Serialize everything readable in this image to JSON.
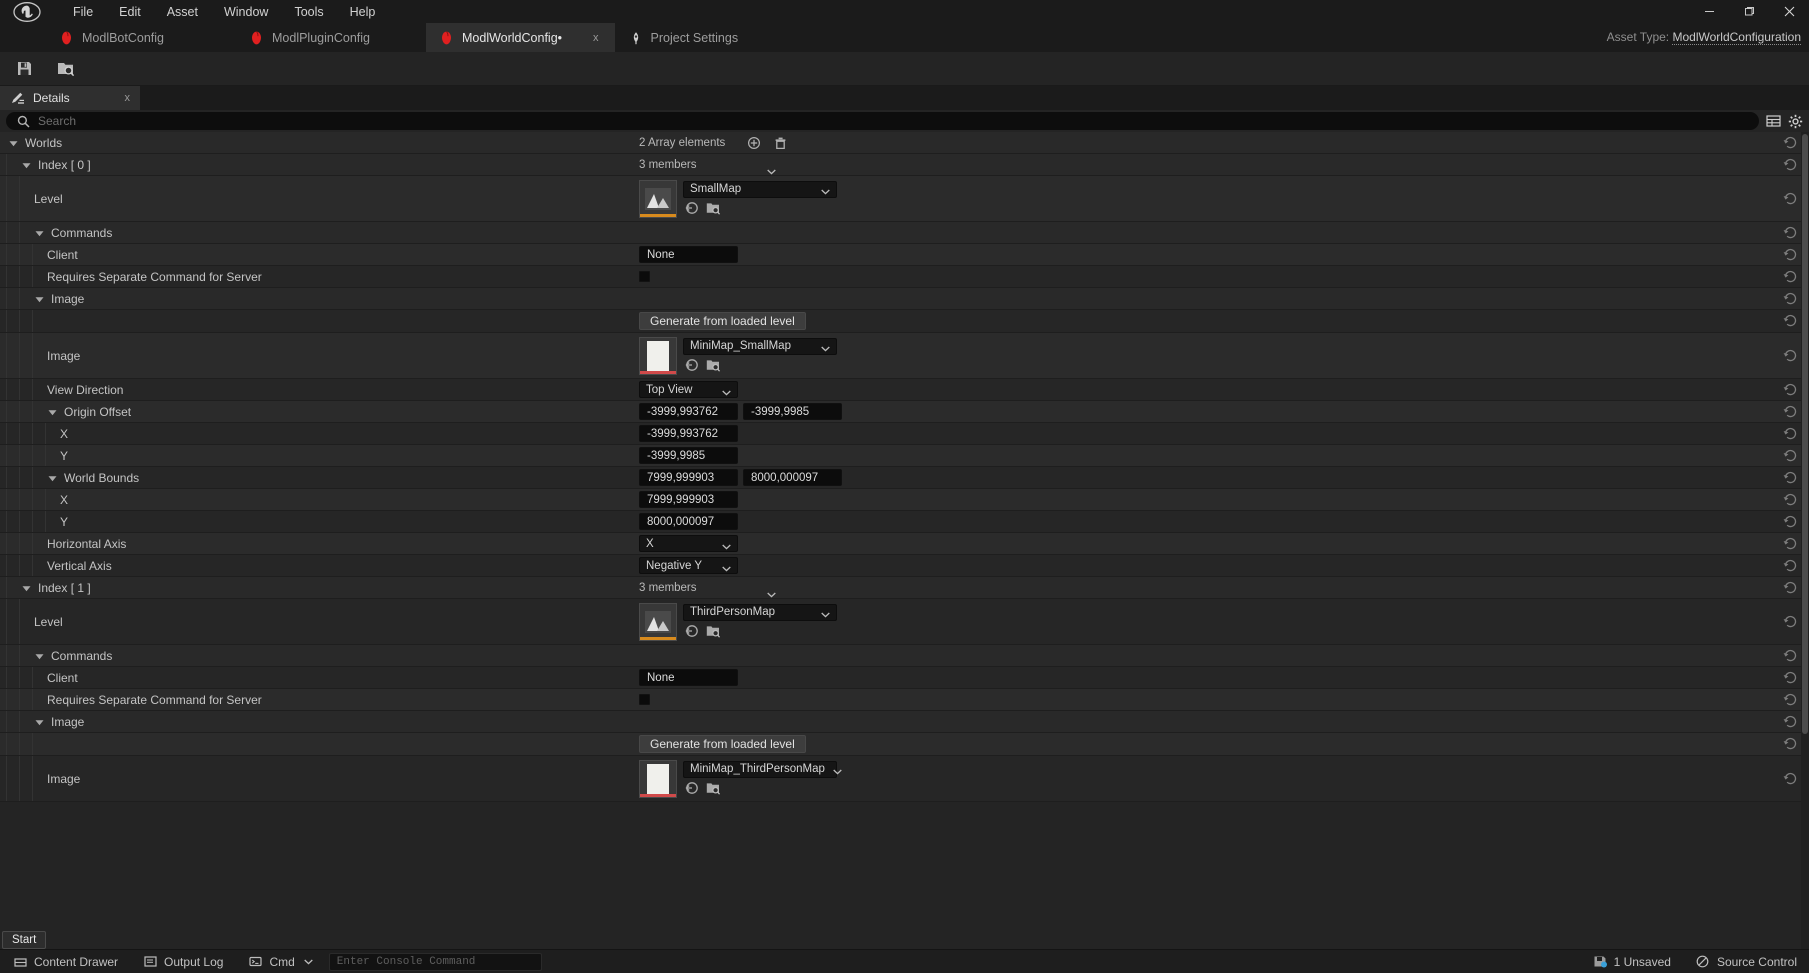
{
  "titlebar": {
    "menu": [
      "File",
      "Edit",
      "Asset",
      "Window",
      "Tools",
      "Help"
    ],
    "minimize": "—",
    "maximize": "❐",
    "close": "✕"
  },
  "tabs": [
    {
      "label": "ModlBotConfig",
      "icon": "ue-asset-icon",
      "active": false,
      "closable": false
    },
    {
      "label": "ModlPluginConfig",
      "icon": "ue-asset-icon",
      "active": false,
      "closable": false
    },
    {
      "label": "ModlWorldConfig•",
      "icon": "ue-asset-icon",
      "active": true,
      "closable": true,
      "close": "x"
    },
    {
      "label": "Project Settings",
      "icon": "settings-asset-icon",
      "active": false,
      "closable": false
    }
  ],
  "asset_type": {
    "prefix": "Asset Type:",
    "value": "ModlWorldConfiguration"
  },
  "toolbar": {
    "save": "save-icon",
    "browse": "browse-icon"
  },
  "panel_tab": {
    "label": "Details",
    "icon": "details-icon",
    "close": "x"
  },
  "search": {
    "placeholder": "Search",
    "value": ""
  },
  "view_buttons": {
    "column": "column-view-icon",
    "settings": "settings-gear-icon"
  },
  "rows": [
    {
      "id": "worlds",
      "label": "Worlds",
      "indent": 0,
      "kind": "array-header",
      "expander": "down",
      "value_text": "2 Array elements",
      "add": "+",
      "delete": "trash"
    },
    {
      "id": "index0",
      "label": "Index [ 0 ]",
      "indent": 1,
      "kind": "struct-header",
      "expander": "down",
      "value_text": "3 members"
    },
    {
      "id": "level0",
      "label": "Level",
      "indent": 2,
      "kind": "asset",
      "asset_value": "SmallMap",
      "thumb_accent": "#d78a1d",
      "thumb_kind": "level"
    },
    {
      "id": "commands0",
      "label": "Commands",
      "indent": 2,
      "kind": "category",
      "expander": "down"
    },
    {
      "id": "client0",
      "label": "Client",
      "indent": 3,
      "kind": "text",
      "text_value": "None"
    },
    {
      "id": "reqsep0",
      "label": "Requires Separate Command for Server",
      "indent": 3,
      "kind": "checkbox",
      "checked": false
    },
    {
      "id": "image0",
      "label": "Image",
      "indent": 2,
      "kind": "category",
      "expander": "down"
    },
    {
      "id": "genbtn0",
      "label": "",
      "indent": 3,
      "kind": "button",
      "button_label": "Generate from loaded level"
    },
    {
      "id": "imageasset0",
      "label": "Image",
      "indent": 3,
      "kind": "asset",
      "asset_value": "MiniMap_SmallMap",
      "thumb_accent": "#d04a4a",
      "thumb_kind": "texture"
    },
    {
      "id": "viewdir0",
      "label": "View Direction",
      "indent": 3,
      "kind": "dropdown",
      "dropdown_value": "Top View"
    },
    {
      "id": "origin0",
      "label": "Origin Offset",
      "indent": 3,
      "kind": "vector2",
      "expander": "down",
      "x": "-3999,993762",
      "y": "-3999,9985"
    },
    {
      "id": "originx0",
      "label": "X",
      "indent": 4,
      "kind": "number",
      "number_value": "-3999,993762"
    },
    {
      "id": "originy0",
      "label": "Y",
      "indent": 4,
      "kind": "number",
      "number_value": "-3999,9985"
    },
    {
      "id": "bounds0",
      "label": "World Bounds",
      "indent": 3,
      "kind": "vector2",
      "expander": "down",
      "x": "7999,999903",
      "y": "8000,000097"
    },
    {
      "id": "boundsx0",
      "label": "X",
      "indent": 4,
      "kind": "number",
      "number_value": "7999,999903"
    },
    {
      "id": "boundsy0",
      "label": "Y",
      "indent": 4,
      "kind": "number",
      "number_value": "8000,000097"
    },
    {
      "id": "haxis0",
      "label": "Horizontal Axis",
      "indent": 3,
      "kind": "dropdown",
      "dropdown_value": "X"
    },
    {
      "id": "vaxis0",
      "label": "Vertical Axis",
      "indent": 3,
      "kind": "dropdown",
      "dropdown_value": "Negative Y"
    },
    {
      "id": "index1",
      "label": "Index [ 1 ]",
      "indent": 1,
      "kind": "struct-header",
      "expander": "down",
      "value_text": "3 members"
    },
    {
      "id": "level1",
      "label": "Level",
      "indent": 2,
      "kind": "asset",
      "asset_value": "ThirdPersonMap",
      "thumb_accent": "#d78a1d",
      "thumb_kind": "level"
    },
    {
      "id": "commands1",
      "label": "Commands",
      "indent": 2,
      "kind": "category",
      "expander": "down"
    },
    {
      "id": "client1",
      "label": "Client",
      "indent": 3,
      "kind": "text",
      "text_value": "None"
    },
    {
      "id": "reqsep1",
      "label": "Requires Separate Command for Server",
      "indent": 3,
      "kind": "checkbox",
      "checked": false
    },
    {
      "id": "image1",
      "label": "Image",
      "indent": 2,
      "kind": "category",
      "expander": "down"
    },
    {
      "id": "genbtn1",
      "label": "",
      "indent": 3,
      "kind": "button",
      "button_label": "Generate from loaded level"
    },
    {
      "id": "imageasset1",
      "label": "Image",
      "indent": 3,
      "kind": "asset",
      "asset_value": "MiniMap_ThirdPersonMap",
      "thumb_accent": "#d04a4a",
      "thumb_kind": "texture"
    }
  ],
  "statusbar": {
    "content_drawer": "Content Drawer",
    "output_log": "Output Log",
    "cmd": "Cmd",
    "console_placeholder": "Enter Console Command",
    "unsaved": "1 Unsaved",
    "source_control": "Source Control",
    "tooltip": "Start"
  },
  "colors": {
    "accent_orange": "#d78a1d",
    "accent_red": "#d04a4a",
    "tab_active_bg": "#2f2f2f",
    "panel_bg": "#242424",
    "row_bg": "#2b2b2b",
    "row_alt_bg": "#262626"
  }
}
